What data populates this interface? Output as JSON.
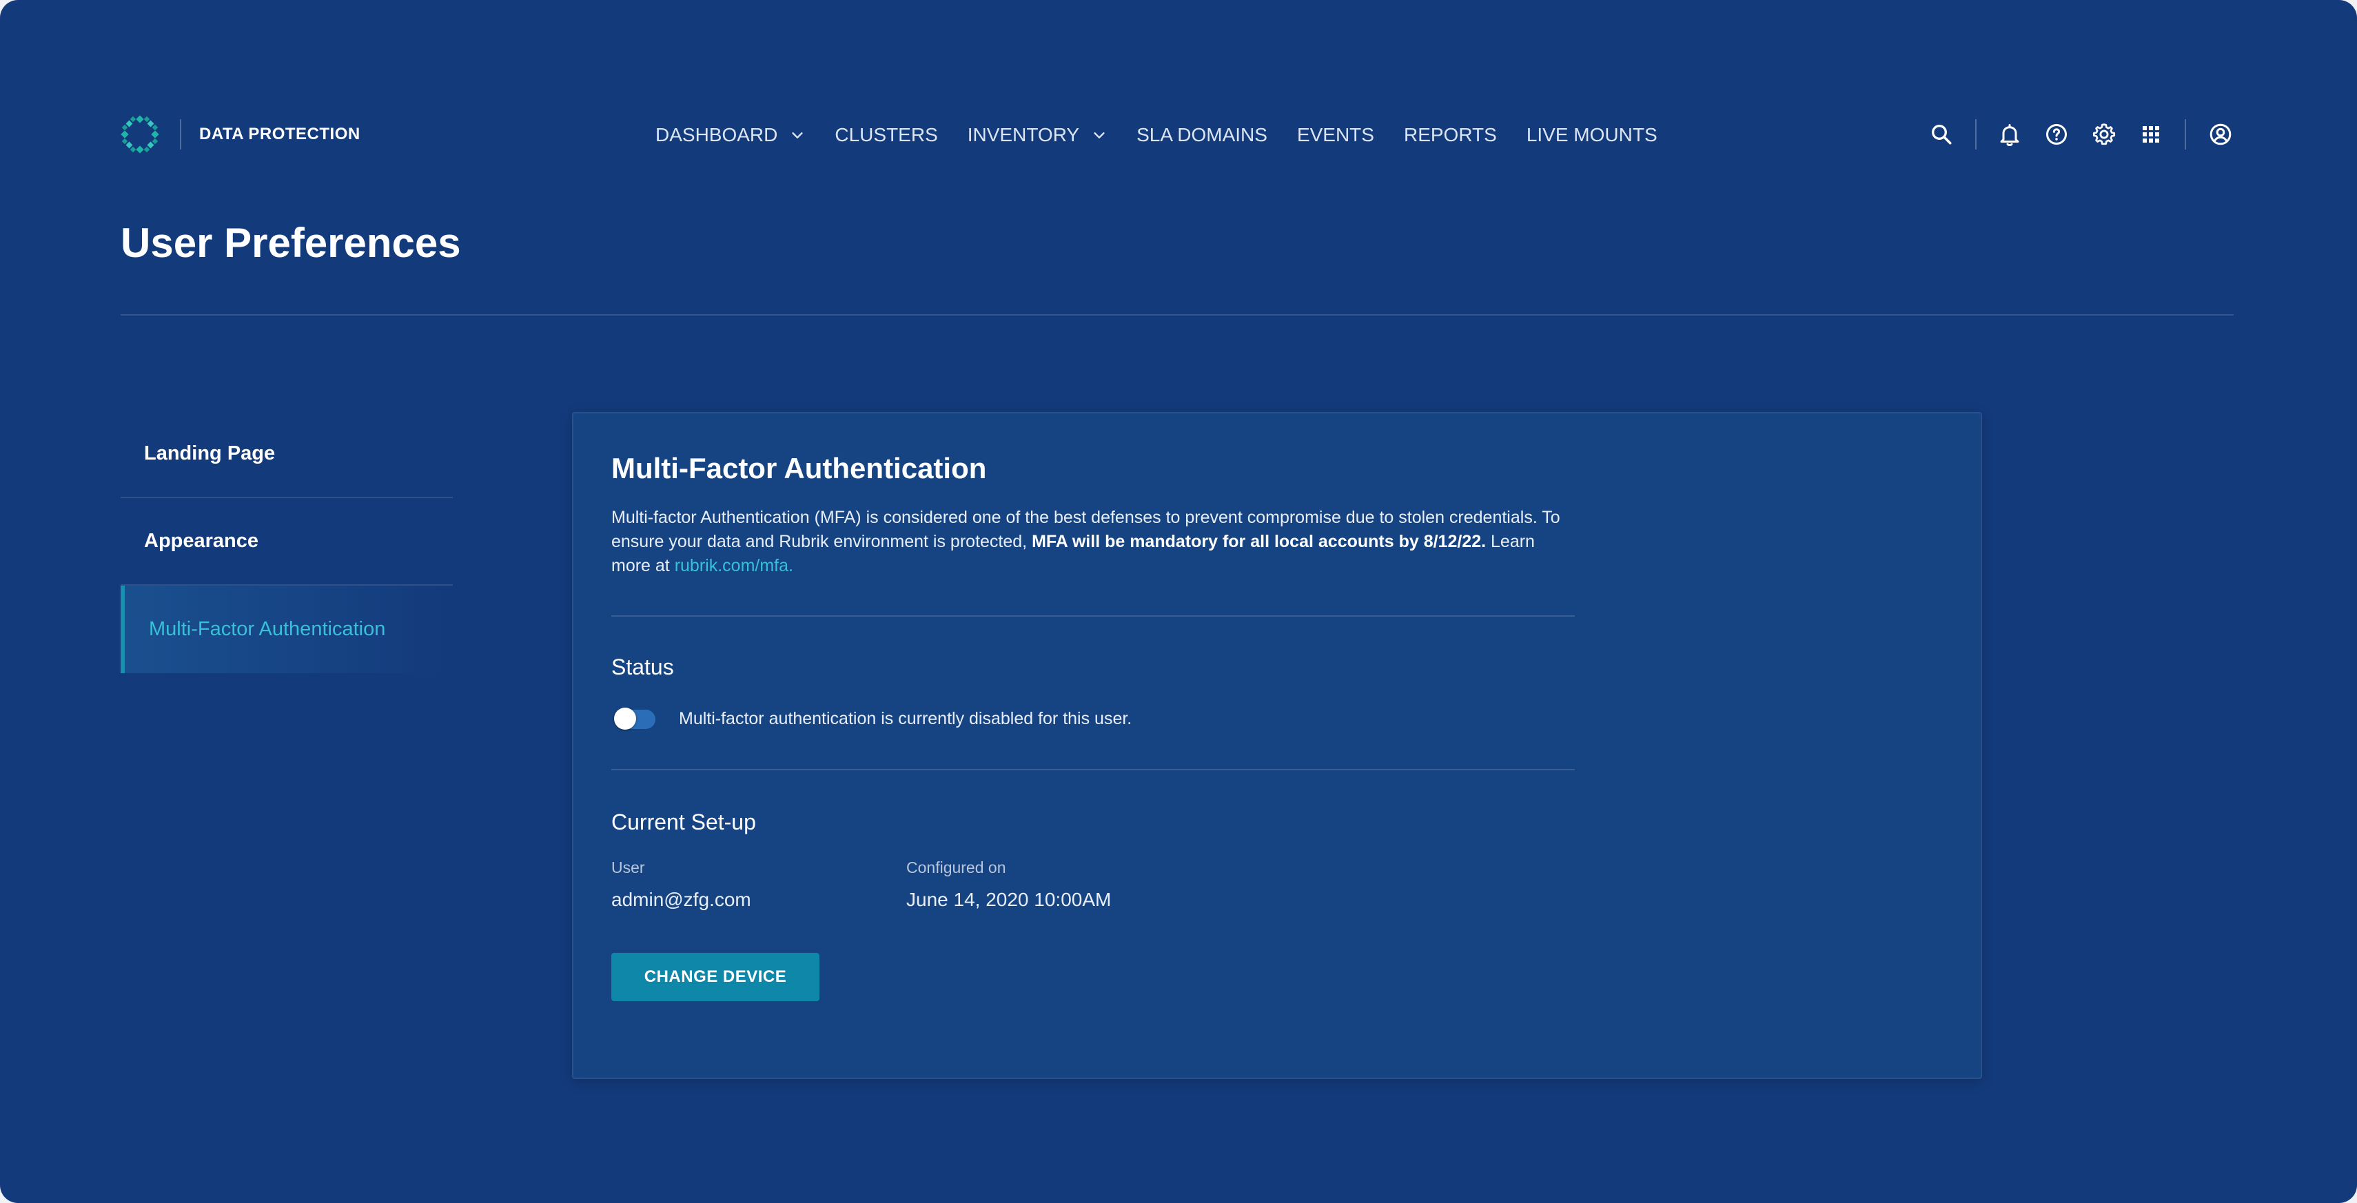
{
  "brand": {
    "name": "DATA PROTECTION",
    "logo_icon": "rubrik-logo-icon"
  },
  "nav": {
    "items": [
      {
        "label": "DASHBOARD",
        "has_dropdown": true
      },
      {
        "label": "CLUSTERS",
        "has_dropdown": false
      },
      {
        "label": "INVENTORY",
        "has_dropdown": true
      },
      {
        "label": "SLA DOMAINS",
        "has_dropdown": false
      },
      {
        "label": "EVENTS",
        "has_dropdown": false
      },
      {
        "label": "REPORTS",
        "has_dropdown": false
      },
      {
        "label": "LIVE MOUNTS",
        "has_dropdown": false
      }
    ]
  },
  "toolbar": {
    "icons": [
      "search-icon",
      "bell-icon",
      "help-icon",
      "gear-icon",
      "apps-grid-icon",
      "user-account-icon"
    ]
  },
  "page": {
    "title": "User Preferences"
  },
  "side_menu": {
    "items": [
      {
        "label": "Landing Page",
        "active": false
      },
      {
        "label": "Appearance",
        "active": false
      },
      {
        "label": "Multi-Factor Authentication",
        "active": true
      }
    ]
  },
  "mfa": {
    "title": "Multi-Factor Authentication",
    "description_part1": "Multi-factor Authentication (MFA) is considered one of the best defenses to prevent compromise due to stolen credentials. To ensure your data and Rubrik environment is protected, ",
    "description_bold": "MFA will be mandatory for all local accounts by 8/12/22.",
    "description_part2": " Learn more at ",
    "link_text": "rubrik.com/mfa.",
    "status": {
      "heading": "Status",
      "enabled": false,
      "text": "Multi-factor authentication is currently disabled for this user."
    },
    "setup": {
      "heading": "Current Set-up",
      "user_label": "User",
      "user_value": "admin@zfg.com",
      "configured_label": "Configured on",
      "configured_value": "June 14, 2020 10:00AM"
    },
    "change_device_label": "CHANGE DEVICE"
  },
  "colors": {
    "background": "#133a7b",
    "card": "#164482",
    "accent": "#38c0d8",
    "button": "#0e87a8",
    "toggle_track": "#2b6db7"
  }
}
